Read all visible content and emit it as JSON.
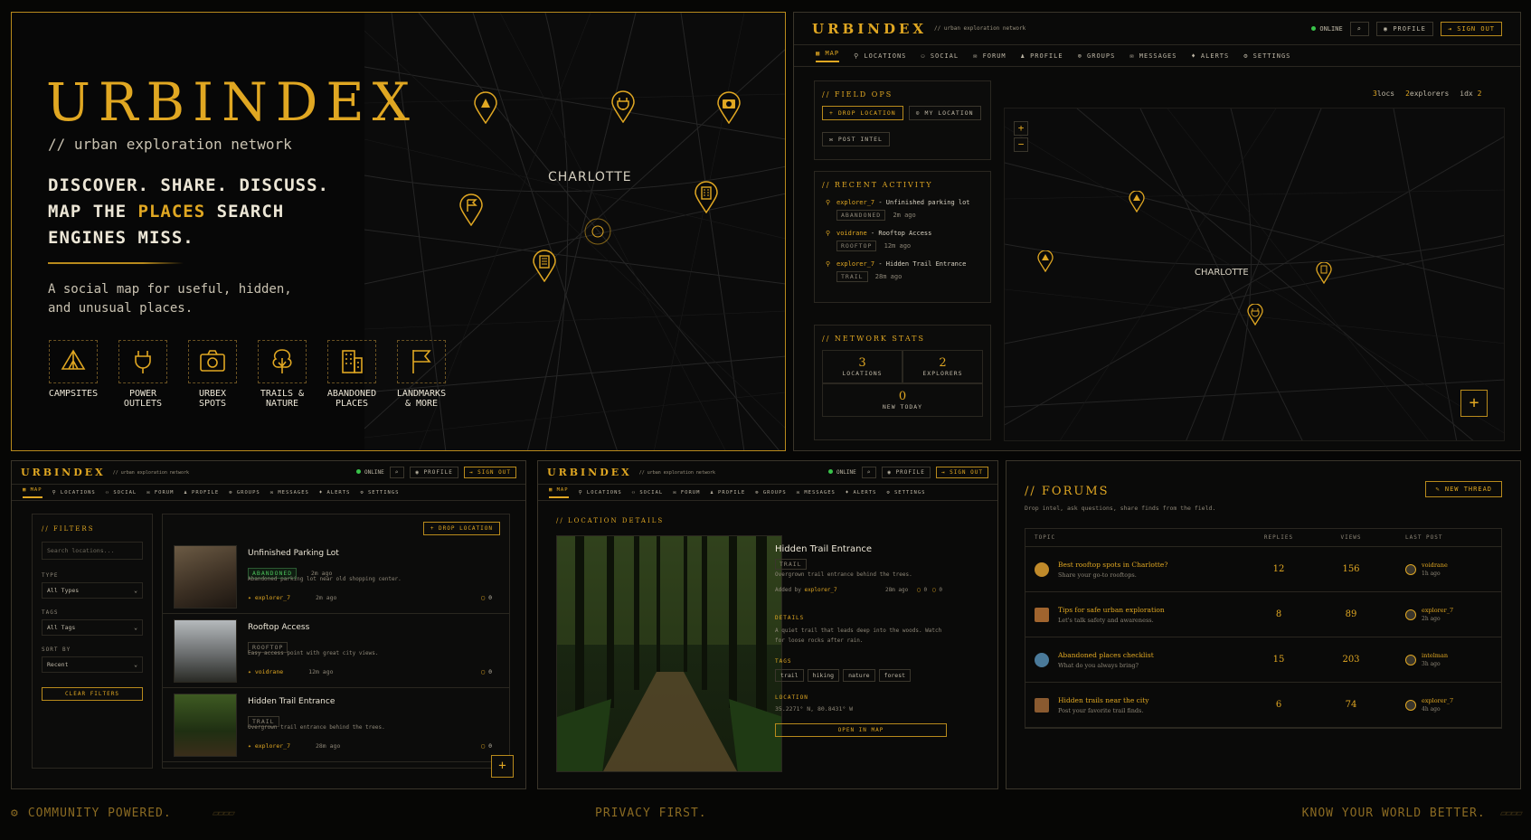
{
  "hero": {
    "logo": "URBINDEX",
    "subtitle": "// urban exploration network",
    "headline_1": "DISCOVER. SHARE. DISCUSS.",
    "headline_2a": "MAP THE ",
    "headline_2b": "PLACES",
    "headline_2c": " SEARCH",
    "headline_3": "ENGINES MISS.",
    "description_1": "A social map for useful, hidden,",
    "description_2": "and unusual places.",
    "map_city": "CHARLOTTE",
    "categories": [
      {
        "l1": "CAMPSITES",
        "l2": "",
        "icon": "tent-icon"
      },
      {
        "l1": "POWER",
        "l2": "OUTLETS",
        "icon": "plug-icon"
      },
      {
        "l1": "URBEX",
        "l2": "SPOTS",
        "icon": "camera-icon"
      },
      {
        "l1": "TRAILS &",
        "l2": "NATURE",
        "icon": "tree-icon"
      },
      {
        "l1": "ABANDONED",
        "l2": "PLACES",
        "icon": "building-icon"
      },
      {
        "l1": "LANDMARKS",
        "l2": "& MORE",
        "icon": "flag-icon"
      }
    ]
  },
  "app": {
    "logo": "URBINDEX",
    "tagline": "// urban exploration network",
    "status": "ONLINE",
    "profile": "PROFILE",
    "sign_out": "SIGN OUT",
    "nav": [
      "MAP",
      "LOCATIONS",
      "SOCIAL",
      "FORUM",
      "PROFILE",
      "GROUPS",
      "MESSAGES",
      "ALERTS",
      "SETTINGS"
    ]
  },
  "map_screen": {
    "field_ops": "// FIELD OPS",
    "drop_location": "+ DROP LOCATION",
    "my_location": "MY LOCATION",
    "post_intel": "POST INTEL",
    "recent_activity": "// RECENT ACTIVITY",
    "activity": [
      {
        "user": "explorer_7",
        "text": " - Unfinished parking lot",
        "tag": "ABANDONED",
        "time": "2m ago"
      },
      {
        "user": "voidrane",
        "text": " - Rooftop Access",
        "tag": "ROOFTOP",
        "time": "12m ago"
      },
      {
        "user": "explorer_7",
        "text": " - Hidden Trail Entrance",
        "tag": "TRAIL",
        "time": "28m ago"
      }
    ],
    "network_stats": "// NETWORK STATS",
    "stats": [
      {
        "value": "3",
        "label": "LOCATIONS"
      },
      {
        "value": "2",
        "label": "EXPLORERS"
      },
      {
        "value": "0",
        "label": "NEW TODAY"
      }
    ],
    "map_stats": {
      "locs_n": "3",
      "locs": "locs",
      "explorers_n": "2",
      "explorers": "explorers",
      "idx": "idx",
      "idx_n": "2"
    },
    "city": "CHARLOTTE",
    "zoom_in": "+",
    "zoom_out": "−",
    "add": "+"
  },
  "list_screen": {
    "filters": "// FILTERS",
    "search_placeholder": "Search locations...",
    "type_label": "TYPE",
    "type_value": "All Types",
    "tags_label": "TAGS",
    "tags_value": "All Tags",
    "sort_label": "SORT BY",
    "sort_value": "Recent",
    "clear": "CLEAR FILTERS",
    "drop": "+ DROP LOCATION",
    "items": [
      {
        "title": "Unfinished Parking Lot",
        "tag": "ABANDONED",
        "time": "2m ago",
        "desc": "Abandoned parking lot near old shopping center.",
        "user": "explorer_7",
        "ago": "2m ago",
        "count": "0"
      },
      {
        "title": "Rooftop Access",
        "tag": "ROOFTOP",
        "time": "",
        "desc": "Easy access point with great city views.",
        "user": "voidrane",
        "ago": "12m ago",
        "count": "0"
      },
      {
        "title": "Hidden Trail Entrance",
        "tag": "TRAIL",
        "time": "",
        "desc": "Overgrown trail entrance behind the trees.",
        "user": "explorer_7",
        "ago": "28m ago",
        "count": "0"
      }
    ],
    "add": "+"
  },
  "detail_screen": {
    "heading": "// LOCATION DETAILS",
    "title": "Hidden Trail Entrance",
    "tag": "TRAIL",
    "short": "Overgrown trail entrance behind the trees.",
    "added_by": "Added by ",
    "user": "explorer_7",
    "ago": "28m ago",
    "c1": "0",
    "c2": "0",
    "details_label": "DETAILS",
    "details_1": "A quiet trail that leads deep into the woods. Watch",
    "details_2": "for loose rocks after rain.",
    "tags_label": "TAGS",
    "tags": [
      "trail",
      "hiking",
      "nature",
      "forest"
    ],
    "location_label": "LOCATION",
    "coords": "35.2271° N, 80.8431° W",
    "open_map": "OPEN IN MAP"
  },
  "forum": {
    "title": "// FORUMS",
    "subtitle": "Drop intel, ask questions, share finds from the field.",
    "new_thread": "✎ NEW THREAD",
    "cols": [
      "TOPIC",
      "REPLIES",
      "VIEWS",
      "LAST POST"
    ],
    "rows": [
      {
        "title": "Best rooftop spots in Charlotte?",
        "sub": "Share your go-to rooftops.",
        "replies": "12",
        "views": "156",
        "user": "voidrane",
        "ago": "1h ago"
      },
      {
        "title": "Tips for safe urban exploration",
        "sub": "Let's talk safety and awareness.",
        "replies": "8",
        "views": "89",
        "user": "explorer_7",
        "ago": "2h ago"
      },
      {
        "title": "Abandoned places checklist",
        "sub": "What do you always bring?",
        "replies": "15",
        "views": "203",
        "user": "intelman",
        "ago": "3h ago"
      },
      {
        "title": "Hidden trails near the city",
        "sub": "Post your favorite trail finds.",
        "replies": "6",
        "views": "74",
        "user": "explorer_7",
        "ago": "4h ago"
      }
    ]
  },
  "footer": {
    "left": "COMMUNITY POWERED.",
    "center": "PRIVACY FIRST.",
    "right": "KNOW YOUR WORLD BETTER."
  },
  "colors": {
    "accent": "#e0a722",
    "background": "#060605",
    "online": "#39c34a"
  }
}
